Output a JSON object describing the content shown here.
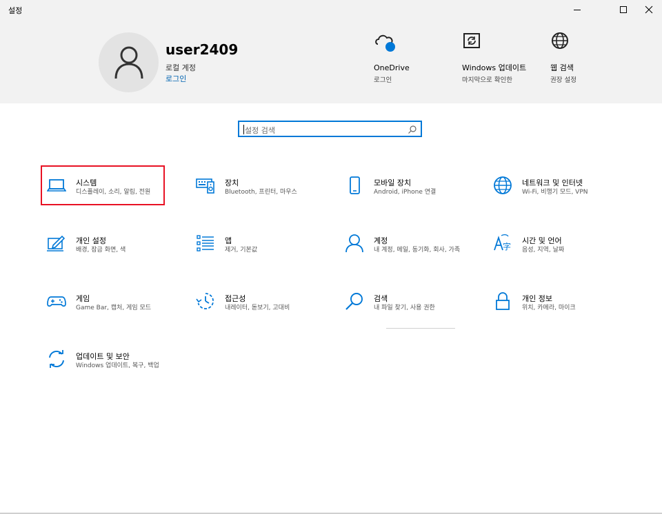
{
  "window": {
    "title": "설정",
    "minimize_icon": "minimize-icon",
    "maximize_icon": "maximize-icon",
    "close_icon": "close-icon"
  },
  "account": {
    "username": "user2409",
    "type": "로컬 계정",
    "signin_link": "로그인"
  },
  "header_items": [
    {
      "title": "OneDrive",
      "subtitle": "로그인",
      "icon": "onedrive-cloud-icon"
    },
    {
      "title": "Windows 업데이트",
      "subtitle": "마지막으로 확인한",
      "icon": "windows-update-icon"
    },
    {
      "title": "웹 검색",
      "subtitle": "권장 설정",
      "icon": "globe-icon"
    }
  ],
  "search": {
    "placeholder": "설정 검색",
    "icon": "search-icon"
  },
  "categories": [
    {
      "title": "시스템",
      "subtitle": "디스플레이, 소리, 알림, 전원",
      "icon": "laptop-icon"
    },
    {
      "title": "장치",
      "subtitle": "Bluetooth, 프린터, 마우스",
      "icon": "keyboard-speaker-icon"
    },
    {
      "title": "모바일 장치",
      "subtitle": "Android, iPhone 연결",
      "icon": "phone-icon"
    },
    {
      "title": "네트워크 및 인터넷",
      "subtitle": "Wi-Fi, 비행기 모드, VPN",
      "icon": "globe-icon"
    },
    {
      "title": "개인 설정",
      "subtitle": "배경, 잠금 화면, 색",
      "icon": "paint-pen-icon"
    },
    {
      "title": "앱",
      "subtitle": "제거, 기본값",
      "icon": "app-list-icon"
    },
    {
      "title": "계정",
      "subtitle": "내 계정, 메일, 동기화, 회사, 가족",
      "icon": "person-icon"
    },
    {
      "title": "시간 및 언어",
      "subtitle": "음성, 지역, 날짜",
      "icon": "language-icon"
    },
    {
      "title": "게임",
      "subtitle": "Game Bar, 캡처, 게임 모드",
      "icon": "gamepad-icon"
    },
    {
      "title": "접근성",
      "subtitle": "내레이터, 돋보기, 고대비",
      "icon": "ease-of-access-icon"
    },
    {
      "title": "검색",
      "subtitle": "내 파일 찾기, 사용 권한",
      "icon": "search-icon"
    },
    {
      "title": "개인 정보",
      "subtitle": "위치, 카메라, 마이크",
      "icon": "lock-icon"
    },
    {
      "title": "업데이트 및 보안",
      "subtitle": "Windows 업데이트, 복구, 백업",
      "icon": "sync-arrows-icon"
    }
  ],
  "colors": {
    "accent": "#0078d7",
    "link": "#0063b1",
    "highlight": "#e81123",
    "header_bg": "#f2f2f2"
  }
}
